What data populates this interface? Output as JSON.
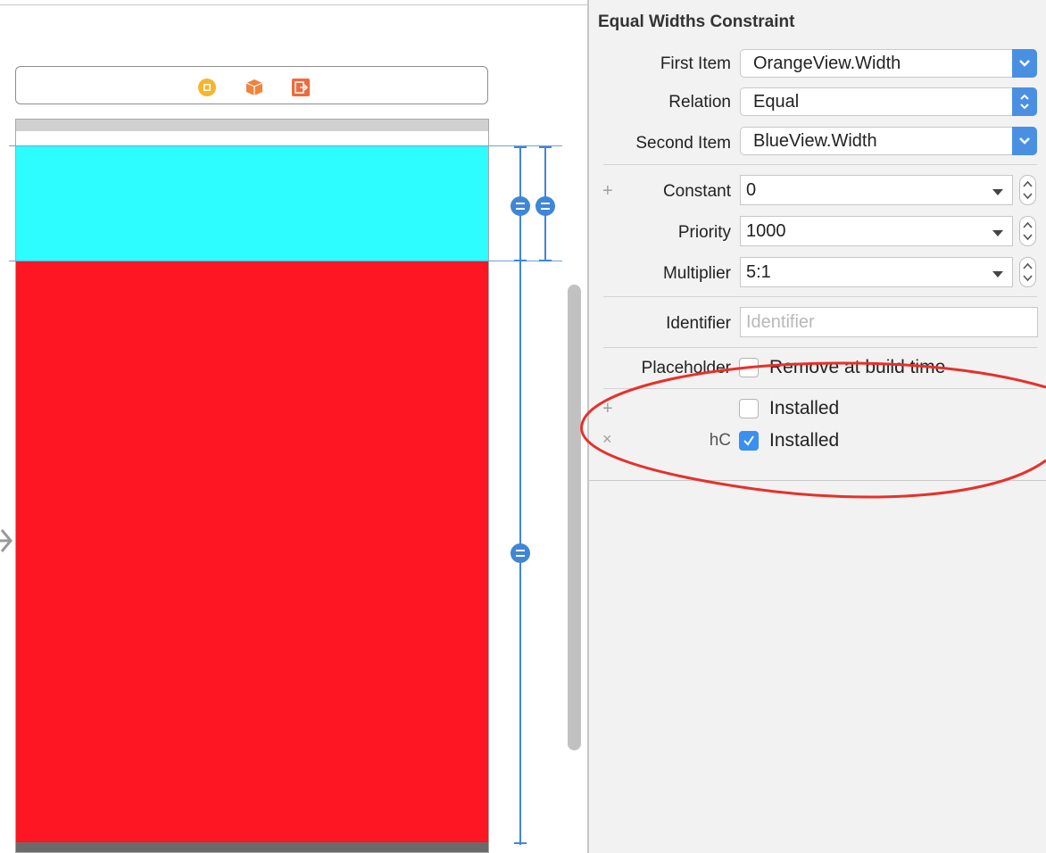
{
  "inspector": {
    "title": "Equal Widths Constraint",
    "first_item": {
      "label": "First Item",
      "value": "OrangeView.Width"
    },
    "relation": {
      "label": "Relation",
      "value": "Equal"
    },
    "second_item": {
      "label": "Second Item",
      "value": "BlueView.Width"
    },
    "constant": {
      "label": "Constant",
      "value": "0"
    },
    "priority": {
      "label": "Priority",
      "value": "1000"
    },
    "multiplier": {
      "label": "Multiplier",
      "value": "5:1"
    },
    "identifier": {
      "label": "Identifier",
      "placeholder": "Identifier",
      "value": ""
    },
    "placeholder": {
      "label": "Placeholder",
      "checkbox_label": "Remove at build time",
      "checked": false
    },
    "installed_default": {
      "label": "Installed",
      "checked": false
    },
    "installed_variation": {
      "size_class": "hC",
      "label": "Installed",
      "checked": true
    }
  },
  "canvas": {
    "colors": {
      "blue_view": "#2dfdfe",
      "red_view": "#fe1622",
      "constraint_line": "#3f86d6",
      "annotation": "#e8302a"
    }
  }
}
